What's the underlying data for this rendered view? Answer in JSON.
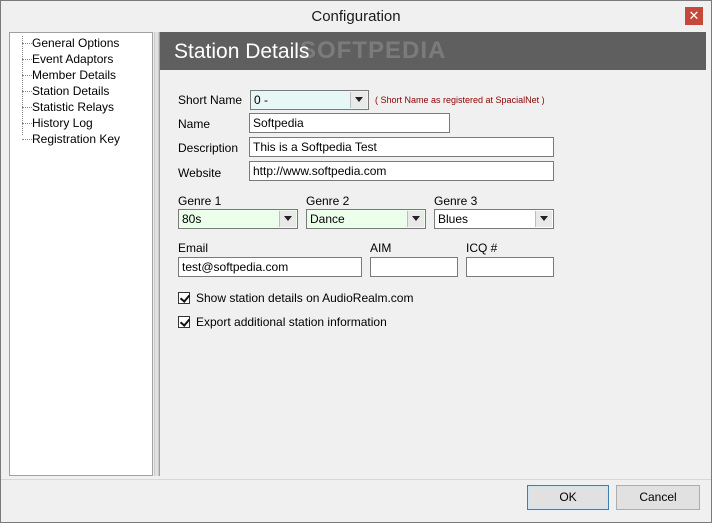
{
  "window": {
    "title": "Configuration",
    "close_glyph": "✕"
  },
  "tree": {
    "items": [
      {
        "label": "General Options"
      },
      {
        "label": "Event Adaptors"
      },
      {
        "label": "Member Details"
      },
      {
        "label": "Station Details"
      },
      {
        "label": "Statistic Relays"
      },
      {
        "label": "History Log"
      },
      {
        "label": "Registration Key"
      }
    ]
  },
  "panel": {
    "title": "Station Details",
    "watermark": "SOFTPEDIA"
  },
  "form": {
    "short_name": {
      "label": "Short Name",
      "value": "0 -",
      "hint": "( Short Name as registered at SpacialNet )"
    },
    "name": {
      "label": "Name",
      "value": "Softpedia"
    },
    "description": {
      "label": "Description",
      "value": "This is a Softpedia Test"
    },
    "website": {
      "label": "Website",
      "value": "http://www.softpedia.com"
    },
    "genre1": {
      "label": "Genre 1",
      "value": "80s"
    },
    "genre2": {
      "label": "Genre 2",
      "value": "Dance"
    },
    "genre3": {
      "label": "Genre 3",
      "value": "Blues"
    },
    "email": {
      "label": "Email",
      "value": "test@softpedia.com"
    },
    "aim": {
      "label": "AIM",
      "value": ""
    },
    "icq": {
      "label": "ICQ #",
      "value": ""
    },
    "show_details": {
      "label": "Show station details on AudioRealm.com",
      "checked": true
    },
    "export_info": {
      "label": "Export additional station information",
      "checked": true
    }
  },
  "buttons": {
    "ok": "OK",
    "cancel": "Cancel"
  }
}
